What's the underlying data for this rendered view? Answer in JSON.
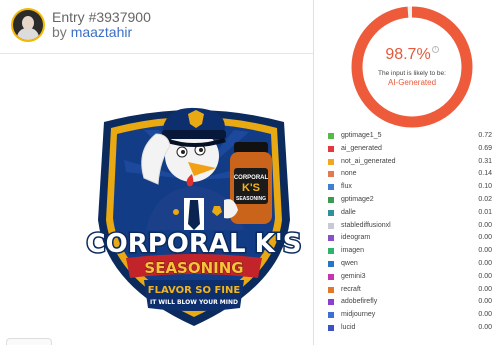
{
  "entry": {
    "title": "Entry #3937900",
    "by_prefix": "by ",
    "author": "maaztahir"
  },
  "logo": {
    "title": "CORPORAL K'S",
    "subtitle": "SEASONING",
    "tagline": "FLAVOR SO FINE",
    "tagline2": "IT WILL BLOW YOUR MIND",
    "bottle_line1": "CORPORAL",
    "bottle_line2": "K'S",
    "bottle_line3": "SEASONING"
  },
  "result": {
    "percent": "98.7%",
    "percent_value": 0.987,
    "caption": "The input is likely to be:",
    "verdict": "AI-Generated",
    "accent": "#ee5b3b"
  },
  "scores": [
    {
      "label": "gptimage1_5",
      "value": "0.72",
      "color": "#56b948"
    },
    {
      "label": "ai_generated",
      "value": "0.69",
      "color": "#e8363b"
    },
    {
      "label": "not_ai_generated",
      "value": "0.31",
      "color": "#f1a820"
    },
    {
      "label": "none",
      "value": "0.14",
      "color": "#e07a4f"
    },
    {
      "label": "flux",
      "value": "0.10",
      "color": "#3f7fcf"
    },
    {
      "label": "gptimage2",
      "value": "0.02",
      "color": "#3d9a53"
    },
    {
      "label": "dalle",
      "value": "0.01",
      "color": "#2f8f9a"
    },
    {
      "label": "stablediffusionxl",
      "value": "0.00",
      "color": "#c9c9d6"
    },
    {
      "label": "ideogram",
      "value": "0.00",
      "color": "#8b4fc6"
    },
    {
      "label": "imagen",
      "value": "0.00",
      "color": "#2eb36e"
    },
    {
      "label": "qwen",
      "value": "0.00",
      "color": "#2a74c8"
    },
    {
      "label": "gemini3",
      "value": "0.00",
      "color": "#c534b3"
    },
    {
      "label": "recraft",
      "value": "0.00",
      "color": "#e2782a"
    },
    {
      "label": "adobefirefly",
      "value": "0.00",
      "color": "#8a3fcf"
    },
    {
      "label": "midjourney",
      "value": "0.00",
      "color": "#3a6fd6"
    },
    {
      "label": "lucid",
      "value": "0.00",
      "color": "#3d52c4"
    }
  ]
}
